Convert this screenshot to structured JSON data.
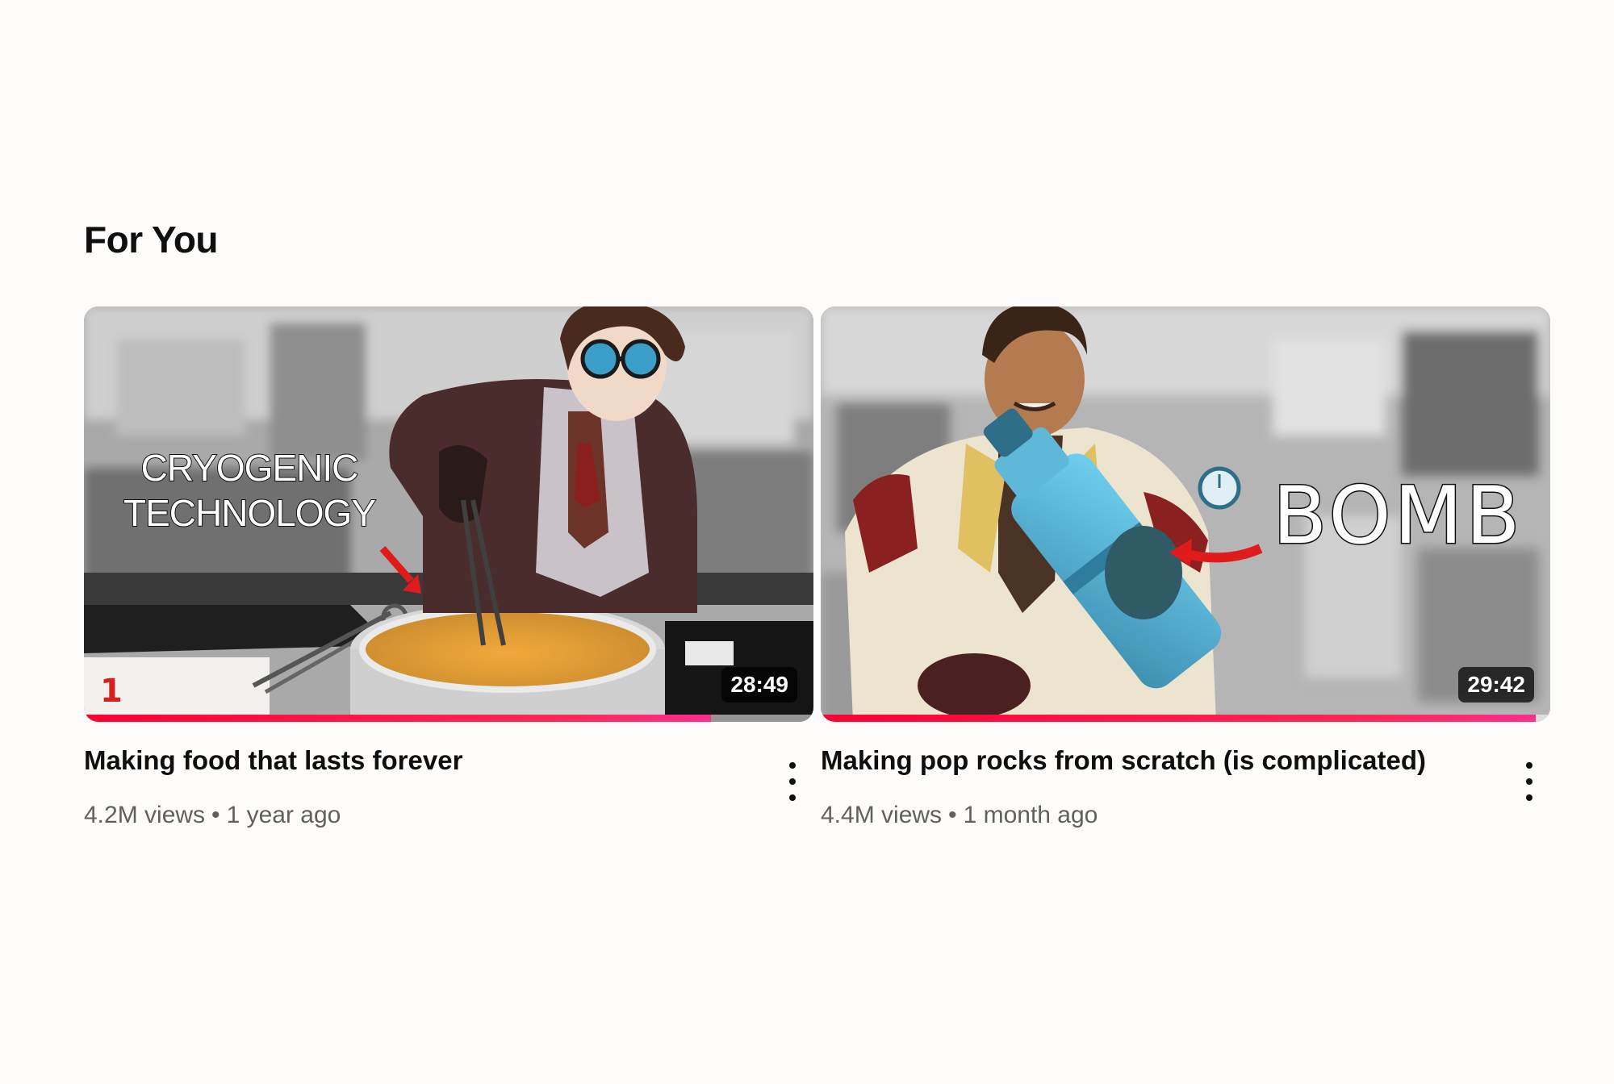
{
  "section": {
    "title": "For You"
  },
  "videos": [
    {
      "title": "Making food that lasts forever",
      "views": "4.2M views",
      "age": "1 year ago",
      "duration": "28:49",
      "thumbnail_text": "CRYOGENIC TECHNOLOGY",
      "watch_progress": 0.86,
      "menu_icon": "more-vert-icon"
    },
    {
      "title": "Making pop rocks from scratch (is complicated)",
      "views": "4.4M views",
      "age": "1 month ago",
      "duration": "29:42",
      "thumbnail_text": "BOMB",
      "watch_progress": 0.98,
      "menu_icon": "more-vert-icon"
    }
  ],
  "colors": {
    "progress": "#ff0033",
    "title_text": "#0f0f0f",
    "meta_text": "#606060"
  }
}
